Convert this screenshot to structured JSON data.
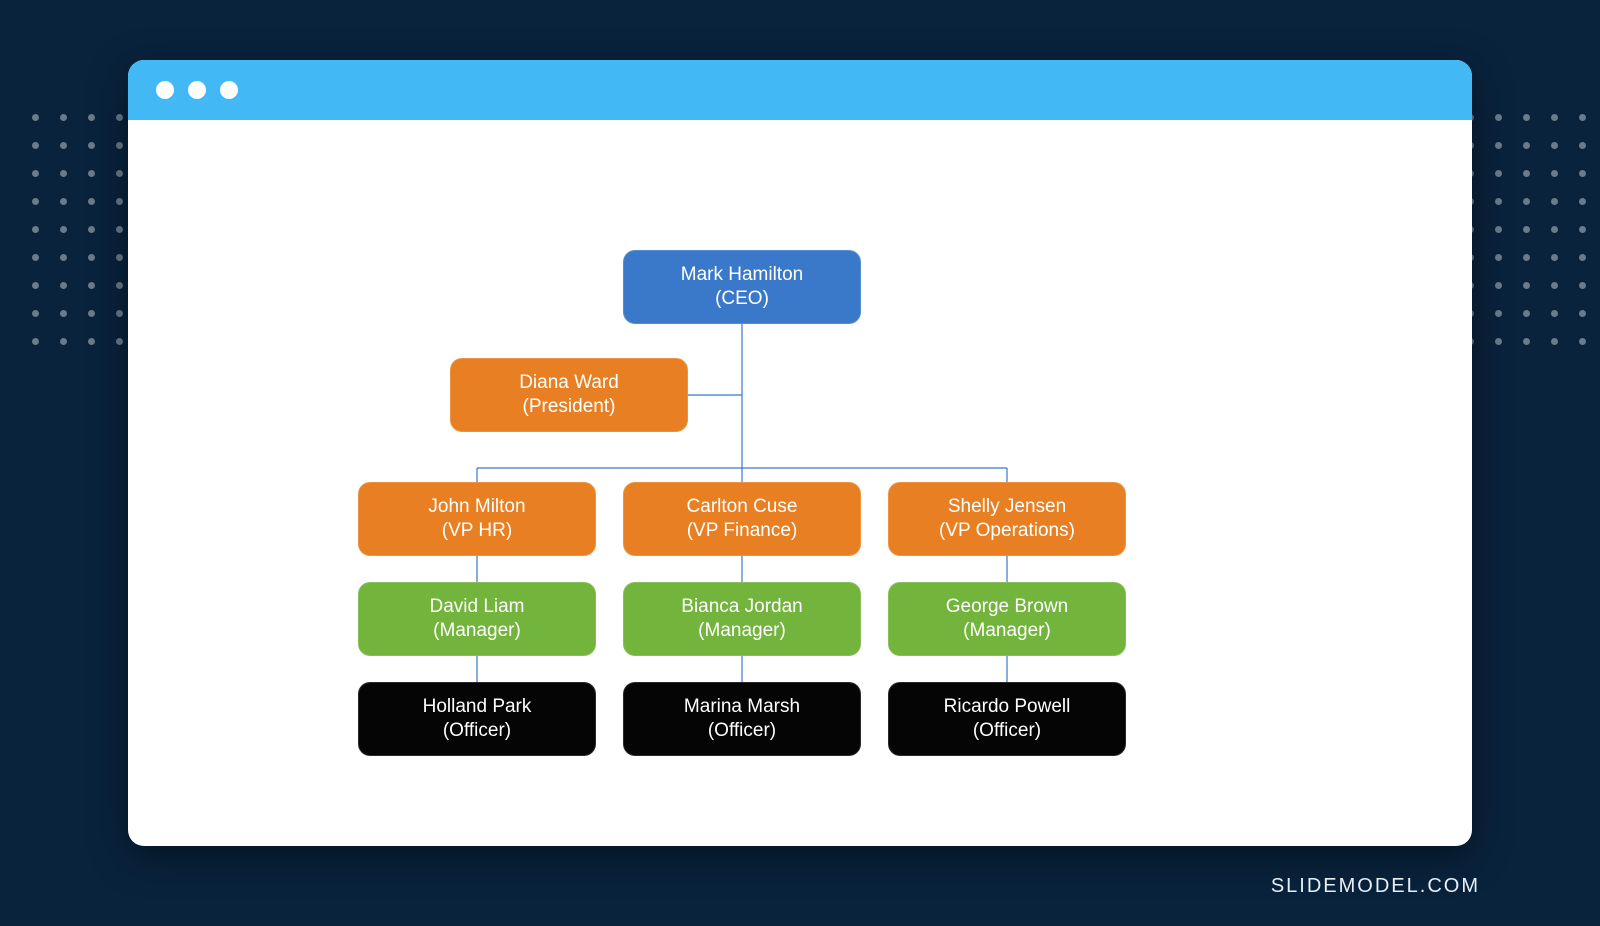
{
  "attribution": "SLIDEMODEL.COM",
  "colors": {
    "page_bg": "#09233d",
    "titlebar": "#42b8f4",
    "node_blue": "#3a78c9",
    "node_orange": "#e88023",
    "node_green": "#73b43c",
    "node_black": "#050505",
    "connector": "#3a78c9"
  },
  "chart_data": {
    "type": "org-chart",
    "root": {
      "name": "Mark Hamilton",
      "title": "CEO",
      "color": "blue",
      "assistant": {
        "name": "Diana Ward",
        "title": "President",
        "color": "orange"
      },
      "children": [
        {
          "name": "John Milton",
          "title": "VP HR",
          "color": "orange",
          "children": [
            {
              "name": "David Liam",
              "title": "Manager",
              "color": "green",
              "children": [
                {
                  "name": "Holland Park",
                  "title": "Officer",
                  "color": "black"
                }
              ]
            }
          ]
        },
        {
          "name": "Carlton Cuse",
          "title": "VP Finance",
          "color": "orange",
          "children": [
            {
              "name": "Bianca Jordan",
              "title": "Manager",
              "color": "green",
              "children": [
                {
                  "name": "Marina Marsh",
                  "title": "Officer",
                  "color": "black"
                }
              ]
            }
          ]
        },
        {
          "name": "Shelly Jensen",
          "title": "VP Operations",
          "color": "orange",
          "children": [
            {
              "name": "George Brown",
              "title": "Manager",
              "color": "green",
              "children": [
                {
                  "name": "Ricardo Powell",
                  "title": "Officer",
                  "color": "black"
                }
              ]
            }
          ]
        }
      ]
    }
  },
  "nodes": {
    "ceo": {
      "name": "Mark Hamilton",
      "title": "(CEO)"
    },
    "president": {
      "name": "Diana Ward",
      "title": "(President)"
    },
    "vp_hr": {
      "name": "John Milton",
      "title": "(VP HR)"
    },
    "vp_fin": {
      "name": "Carlton Cuse",
      "title": "(VP Finance)"
    },
    "vp_ops": {
      "name": "Shelly Jensen",
      "title": "(VP Operations)"
    },
    "mgr_hr": {
      "name": "David Liam",
      "title": "(Manager)"
    },
    "mgr_fin": {
      "name": "Bianca Jordan",
      "title": "(Manager)"
    },
    "mgr_ops": {
      "name": "George Brown",
      "title": "(Manager)"
    },
    "off_hr": {
      "name": "Holland Park",
      "title": "(Officer)"
    },
    "off_fin": {
      "name": "Marina Marsh",
      "title": "(Officer)"
    },
    "off_ops": {
      "name": "Ricardo Powell",
      "title": "(Officer)"
    }
  }
}
